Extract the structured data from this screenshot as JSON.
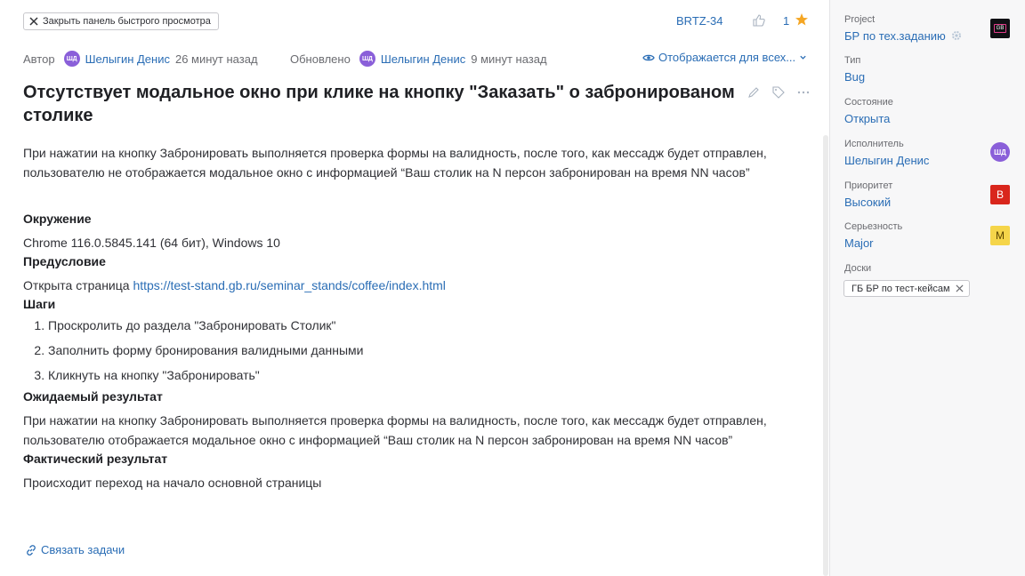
{
  "header": {
    "close_label": "Закрыть панель быстрого просмотра",
    "issue_key": "BRTZ-34",
    "like_count": "1",
    "author_label": "Автор",
    "author_initials": "ШД",
    "author_name": "Шелыгин Денис",
    "created_ago": "26 минут назад",
    "updated_label": "Обновлено",
    "updater_initials": "ШД",
    "updater_name": "Шелыгин Денис",
    "updated_ago": "9 минут назад",
    "visibility": "Отображается для всех..."
  },
  "issue": {
    "title": "Отсутствует модальное окно при клике на кнопку \"Заказать\" о забронированом столике",
    "description": "При нажатии на кнопку Забронировать выполняется проверка формы на валидность, после того, как мессадж будет отправлен, пользователю не отображается модальное окно с информацией “Ваш столик на N персон забронирован на время NN часов”",
    "env_heading": "Окружение",
    "env_text": "Chrome 116.0.5845.141 (64 бит), Windows 10",
    "precondition_heading": "Предусловие",
    "precondition_text": "Открыта страница",
    "precondition_link": "https://test-stand.gb.ru/seminar_stands/coffee/index.html",
    "steps_heading": "Шаги",
    "steps": [
      "Проскролить до раздела \"Забронировать Столик\"",
      "Заполнить форму бронирования валидными данными",
      "Кликнуть на кнопку \"Забронировать\""
    ],
    "expected_heading": "Ожидаемый результат",
    "expected_text": "При нажатии на кнопку Забронировать выполняется проверка формы на валидность, после того, как мессадж будет отправлен, пользователю отображается модальное окно с информацией “Ваш столик на N персон забронирован на время NN часов”",
    "actual_heading": "Фактический результат",
    "actual_text": "Происходит переход на начало основной страницы",
    "link_tasks": "Связать задачи"
  },
  "sidebar": {
    "project_label": "Project",
    "project_value": "БР по тех.заданию",
    "project_logo_text": "GB",
    "type_label": "Тип",
    "type_value": "Bug",
    "status_label": "Состояние",
    "status_value": "Открыта",
    "assignee_label": "Исполнитель",
    "assignee_value": "Шелыгин Денис",
    "assignee_initials": "ШД",
    "priority_label": "Приоритет",
    "priority_value": "Высокий",
    "priority_badge": "В",
    "severity_label": "Серьезность",
    "severity_value": "Major",
    "severity_badge": "M",
    "boards_label": "Доски",
    "board_chip": "ГБ БР по тест-кейсам"
  },
  "colors": {
    "link": "#2a6db5",
    "avatar": "#8a5fd9",
    "priority_high": "#d9261c",
    "severity_major": "#f5d54a",
    "star": "#f5a623"
  },
  "icons": [
    "close-icon",
    "thumbs-up-icon",
    "star-icon",
    "eye-icon",
    "chevron-down-icon",
    "pencil-icon",
    "tag-icon",
    "more-icon",
    "link-icon",
    "gear-icon"
  ]
}
